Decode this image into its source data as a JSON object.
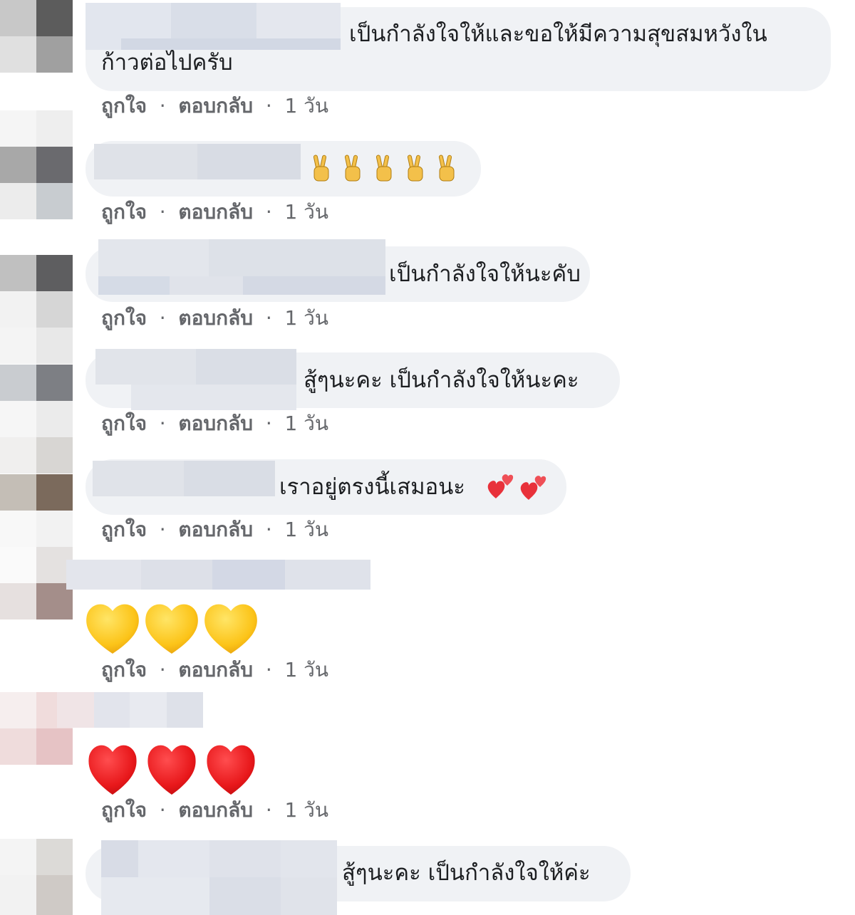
{
  "actions": {
    "like": "ถูกใจ",
    "reply": "ตอบกลับ",
    "separator": "·",
    "time": "1 วัน"
  },
  "comments": [
    {
      "text_line1": "เป็นกำลังใจให้และขอให้มีความสุขสมหวังใน",
      "text_line2": "ก้าวต่อไปครับ"
    },
    {
      "text": "",
      "emoji": "victory-hand-icon"
    },
    {
      "text": "เป็นกำลังใจให้นะคับ"
    },
    {
      "text": "สู้ๆนะคะ เป็นกำลังใจให้นะคะ"
    },
    {
      "text": "เราอยู่ตรงนี้เสมอนะ",
      "emoji": "two-hearts-icon"
    },
    {
      "emoji": "yellow-heart-icon"
    },
    {
      "emoji": "red-heart-icon"
    },
    {
      "text": "สู้ๆนะคะ เป็นกำลังใจให้ค่ะ"
    }
  ],
  "colors": {
    "bubble": "#f0f2f5",
    "meta_text": "#65676b",
    "yellow_heart": "#fcc419",
    "red_heart": "#e8181b",
    "victory_hand": "#f3c04a"
  }
}
